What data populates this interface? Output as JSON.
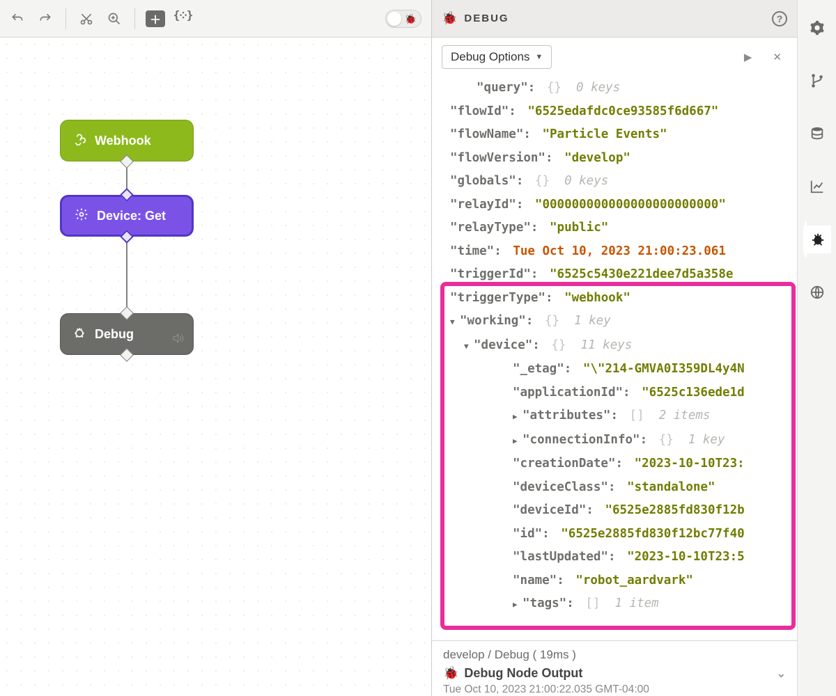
{
  "debug_panel": {
    "title": "DEBUG",
    "options_label": "Debug Options"
  },
  "nodes": {
    "webhook": "Webhook",
    "device_get": "Device: Get",
    "debug": "Debug"
  },
  "tree": {
    "query_key": "\"query\"",
    "query_meta_bracket": "{}",
    "query_meta": "0 keys",
    "flowId_key": "\"flowId\"",
    "flowId_val": "\"6525edafdc0ce93585f6d667\"",
    "flowName_key": "\"flowName\"",
    "flowName_val": "\"Particle Events\"",
    "flowVersion_key": "\"flowVersion\"",
    "flowVersion_val": "\"develop\"",
    "globals_key": "\"globals\"",
    "globals_meta_bracket": "{}",
    "globals_meta": "0 keys",
    "relayId_key": "\"relayId\"",
    "relayId_val": "\"000000000000000000000000\"",
    "relayType_key": "\"relayType\"",
    "relayType_val": "\"public\"",
    "time_key": "\"time\"",
    "time_val": "Tue Oct 10, 2023 21:00:23.061",
    "triggerId_key": "\"triggerId\"",
    "triggerId_val": "\"6525c5430e221dee7d5a358e",
    "triggerType_key": "\"triggerType\"",
    "triggerType_val": "\"webhook\"",
    "working_key": "\"working\"",
    "working_meta_bracket": "{}",
    "working_meta": "1 key",
    "device_key": "\"device\"",
    "device_meta_bracket": "{}",
    "device_meta": "11 keys",
    "etag_key": "\"_etag\"",
    "etag_val": "\"\\\"214-GMVA0I359DL4y4N",
    "applicationId_key": "\"applicationId\"",
    "applicationId_val": "\"6525c136ede1d",
    "attributes_key": "\"attributes\"",
    "attributes_meta_bracket": "[]",
    "attributes_meta": "2 items",
    "connectionInfo_key": "\"connectionInfo\"",
    "connectionInfo_meta_bracket": "{}",
    "connectionInfo_meta": "1 key",
    "creationDate_key": "\"creationDate\"",
    "creationDate_val": "\"2023-10-10T23:",
    "deviceClass_key": "\"deviceClass\"",
    "deviceClass_val": "\"standalone\"",
    "deviceId_key": "\"deviceId\"",
    "deviceId_val": "\"6525e2885fd830f12b",
    "id_key": "\"id\"",
    "id_val": "\"6525e2885fd830f12bc77f40",
    "lastUpdated_key": "\"lastUpdated\"",
    "lastUpdated_val": "\"2023-10-10T23:5",
    "name_key": "\"name\"",
    "name_val": "\"robot_aardvark\"",
    "tags_key": "\"tags\"",
    "tags_meta_bracket": "[]",
    "tags_meta": "1 item"
  },
  "footer": {
    "path": "develop / Debug ( 19ms )",
    "title": "Debug Node Output",
    "timestamp": "Tue Oct 10, 2023 21:00:22.035 GMT-04:00"
  }
}
